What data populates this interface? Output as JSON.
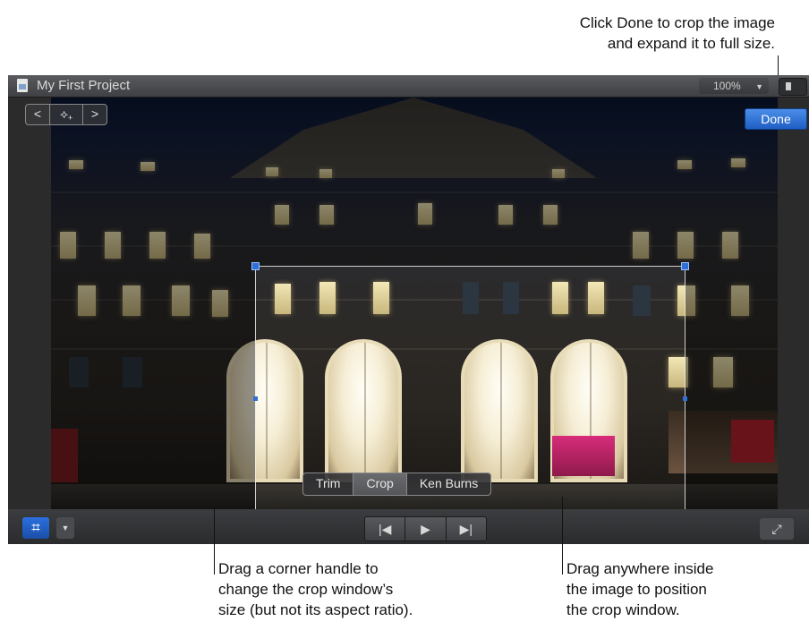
{
  "callouts": {
    "done": [
      "Click Done to crop the image",
      "and expand it to full size."
    ],
    "corner": [
      "Drag a corner handle to",
      "change the crop window’s",
      "size (but not its aspect ratio)."
    ],
    "drag": [
      "Drag anywhere inside",
      "the image to position",
      "the crop window."
    ]
  },
  "viewer": {
    "title": "My First Project",
    "zoom": "100%",
    "zoom_arrow": "▼",
    "done_label": "Done",
    "nav_prev": "<",
    "nav_mid": "⟡₊",
    "nav_next": ">",
    "crop_modes": [
      "Trim",
      "Crop",
      "Ken Burns"
    ],
    "active_mode": "Crop",
    "crop_tool_icon": "crop-icon",
    "transport": {
      "prev": "|◀",
      "play": "▶",
      "next": "▶|"
    },
    "fullscreen_glyph": "⤢"
  }
}
